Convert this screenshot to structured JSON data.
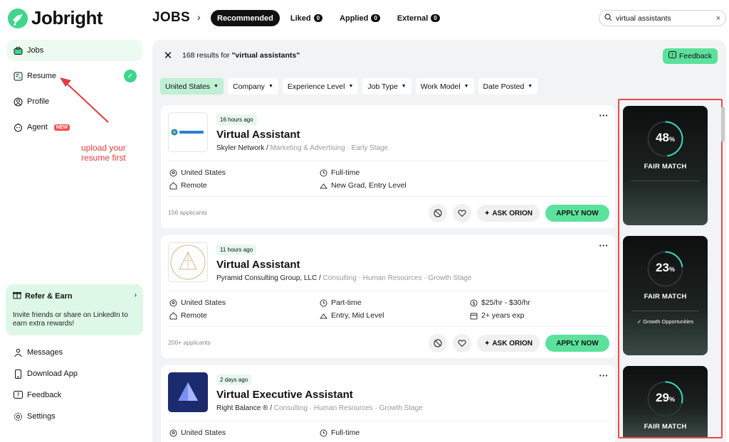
{
  "brand": {
    "name": "Jobright",
    "accent": "#3ed58c"
  },
  "sidebar": {
    "items": [
      {
        "label": "Jobs",
        "icon": "briefcase-icon"
      },
      {
        "label": "Resume",
        "icon": "resume-icon"
      },
      {
        "label": "Profile",
        "icon": "user-icon"
      },
      {
        "label": "Agent",
        "icon": "agent-icon",
        "badge": "NEW"
      }
    ],
    "refer": {
      "title": "Refer & Earn",
      "description": "Invite friends or share on LinkedIn to earn extra rewards!"
    },
    "bottom": [
      {
        "label": "Messages"
      },
      {
        "label": "Download App"
      },
      {
        "label": "Feedback"
      },
      {
        "label": "Settings"
      }
    ]
  },
  "annotation": {
    "text": "upload your resume first",
    "color": "#e23c3c"
  },
  "header": {
    "title": "JOBS",
    "tabs": [
      {
        "label": "Recommended"
      },
      {
        "label": "Liked",
        "count": "0"
      },
      {
        "label": "Applied",
        "count": "0"
      },
      {
        "label": "External",
        "count": "0"
      }
    ],
    "search": {
      "value": "virtual assistants"
    }
  },
  "results": {
    "count_text": "168 results for ",
    "query": "\"virtual assistants\"",
    "feedback_label": "Feedback"
  },
  "filters": [
    {
      "label": "United States"
    },
    {
      "label": "Company"
    },
    {
      "label": "Experience Level"
    },
    {
      "label": "Job Type"
    },
    {
      "label": "Work Model"
    },
    {
      "label": "Date Posted"
    }
  ],
  "actions": {
    "ask": "ASK ORION",
    "apply": "APPLY NOW"
  },
  "jobs": [
    {
      "posted": "16 hours ago",
      "title": "Virtual Assistant",
      "company": "Skyler Network",
      "tags": "Marketing & Advertising · Early Stage",
      "location": "United States",
      "model": "Remote",
      "type": "Full-time",
      "level": "New Grad, Entry Level",
      "applicants": "156 applicants",
      "match": {
        "percent": 48,
        "label": "FAIR MATCH"
      }
    },
    {
      "posted": "11 hours ago",
      "title": "Virtual Assistant",
      "company": "Pyramid Consulting Group, LLC",
      "tags": "Consulting · Human Resources · Growth Stage",
      "location": "United States",
      "model": "Remote",
      "type": "Part-time",
      "level": "Entry, Mid Level",
      "salary": "$25/hr - $30/hr",
      "experience": "2+ years exp",
      "applicants": "200+ applicants",
      "match": {
        "percent": 23,
        "label": "FAIR MATCH",
        "reason": "✓ Growth Opportunities"
      }
    },
    {
      "posted": "2 days ago",
      "title": "Virtual Executive Assistant",
      "company": "Right Balance ®",
      "tags": "Consulting · Human Resources · Growth Stage",
      "location": "United States",
      "type": "Full-time",
      "match": {
        "percent": 29,
        "label": "FAIR MATCH"
      }
    }
  ]
}
